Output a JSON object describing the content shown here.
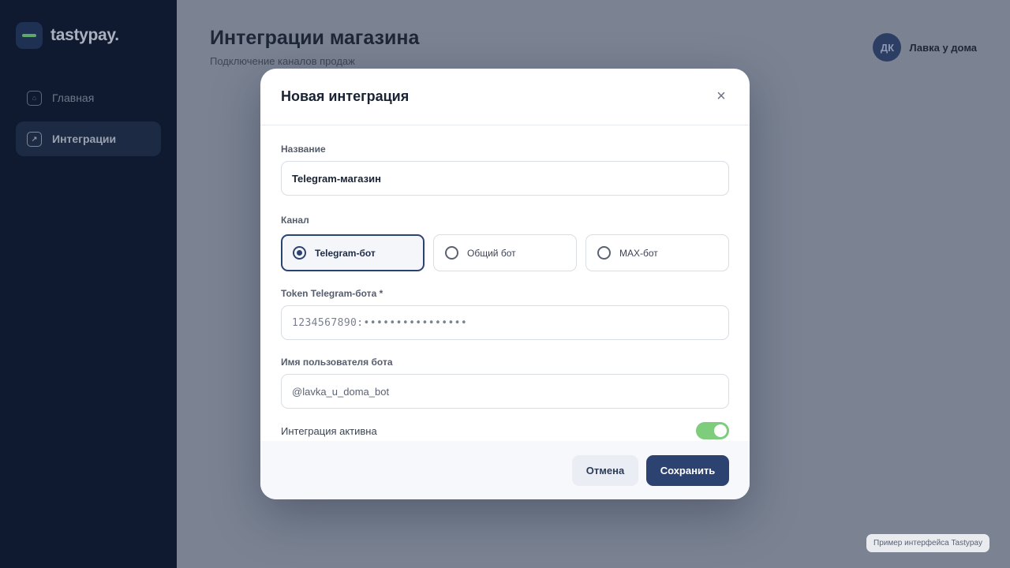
{
  "sidebar": {
    "logo_text": "tastypay.",
    "items": [
      {
        "label": "Главная",
        "icon": "home-icon",
        "active": false
      },
      {
        "label": "Интеграции",
        "icon": "external-link-icon",
        "active": true
      }
    ]
  },
  "header": {
    "title": "Интеграции магазина",
    "subtitle": "Подключение каналов продаж",
    "user": {
      "initials": "ДК",
      "name": "Лавка у дома"
    }
  },
  "modal": {
    "title": "Новая интеграция",
    "close_icon": "close-icon",
    "fields": {
      "name_label": "Название",
      "name_value": "Telegram-магазин",
      "channel_label": "Канал",
      "channels": [
        {
          "label": "Telegram-бот",
          "selected": true
        },
        {
          "label": "Общий бот",
          "selected": false
        },
        {
          "label": "MAX-бот",
          "selected": false
        }
      ],
      "token_label": "Token Telegram-бота *",
      "token_placeholder": "1234567890:••••••••••••••••",
      "username_label": "Имя пользователя бота",
      "username_placeholder": "@lavka_u_doma_bot",
      "active_label": "Интеграция активна",
      "active_on": true
    },
    "footer": {
      "cancel_label": "Отмена",
      "save_label": "Сохранить"
    }
  },
  "watermark": "Пример интерфейса Tastypay",
  "colors": {
    "sidebar_bg": "#0f1a30",
    "primary": "#2c4372",
    "toggle_on": "#7dcd7d",
    "overlay": "#7b8393"
  }
}
